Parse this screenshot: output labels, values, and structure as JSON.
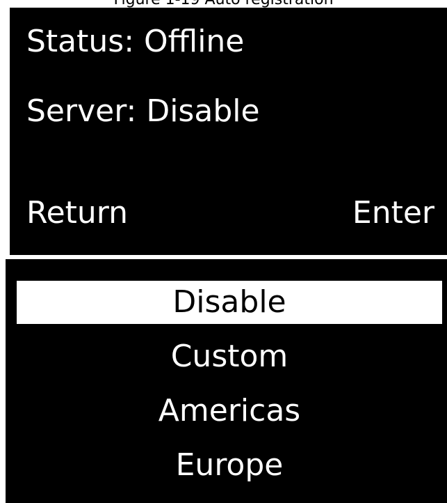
{
  "caption": "Figure 1-19 Auto registration",
  "status_screen": {
    "status_line": "Status: Offline",
    "server_line": "Server: Disable",
    "return_label": "Return",
    "enter_label": "Enter"
  },
  "server_menu": {
    "selected_index": 0,
    "items": [
      {
        "label": "Disable"
      },
      {
        "label": "Custom"
      },
      {
        "label": "Americas"
      },
      {
        "label": "Europe"
      }
    ]
  }
}
